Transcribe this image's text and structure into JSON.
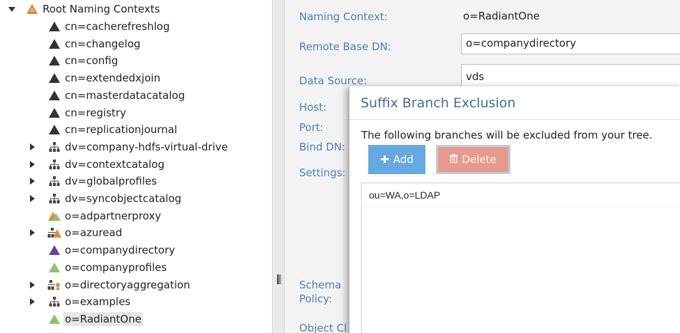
{
  "tree": {
    "root": {
      "label": "Root Naming Contexts",
      "expanded": true
    },
    "items": [
      {
        "label": "cn=cacherefreshlog",
        "icon": "triangle-black-icon",
        "expander": "none"
      },
      {
        "label": "cn=changelog",
        "icon": "triangle-black-icon",
        "expander": "none"
      },
      {
        "label": "cn=config",
        "icon": "triangle-black-icon",
        "expander": "none"
      },
      {
        "label": "cn=extendedxjoin",
        "icon": "triangle-black-icon",
        "expander": "none"
      },
      {
        "label": "cn=masterdatacatalog",
        "icon": "triangle-black-icon",
        "expander": "none"
      },
      {
        "label": "cn=registry",
        "icon": "triangle-black-icon",
        "expander": "none"
      },
      {
        "label": "cn=replicationjournal",
        "icon": "triangle-black-icon",
        "expander": "none"
      },
      {
        "label": "dv=company-hdfs-virtual-drive",
        "icon": "hierarchy-icon",
        "expander": "collapsed"
      },
      {
        "label": "dv=contextcatalog",
        "icon": "hierarchy-icon",
        "expander": "collapsed"
      },
      {
        "label": "dv=globalprofiles",
        "icon": "hierarchy-icon",
        "expander": "collapsed"
      },
      {
        "label": "dv=syncobjectcatalog",
        "icon": "hierarchy-icon",
        "expander": "collapsed"
      },
      {
        "label": "o=adpartnerproxy",
        "icon": "proxy-triangle-icon",
        "expander": "none"
      },
      {
        "label": "o=azuread",
        "icon": "hierarchy-triangle-icon",
        "expander": "collapsed"
      },
      {
        "label": "o=companydirectory",
        "icon": "triangle-purple-icon",
        "expander": "none"
      },
      {
        "label": "o=companyprofiles",
        "icon": "triangle-green-icon",
        "expander": "none"
      },
      {
        "label": "o=directoryaggregation",
        "icon": "aggregation-icon",
        "expander": "collapsed"
      },
      {
        "label": "o=examples",
        "icon": "hierarchy-icon",
        "expander": "collapsed"
      },
      {
        "label": "o=RadiantOne",
        "icon": "triangle-green-icon",
        "expander": "none",
        "selected": true
      }
    ]
  },
  "properties": {
    "naming_context_label": "Naming Context:",
    "naming_context_value": "o=RadiantOne",
    "remote_base_dn_label": "Remote Base DN:",
    "remote_base_dn_value": "o=companydirectory",
    "data_source_label": "Data Source:",
    "data_source_value": "vds",
    "host_label": "Host:",
    "port_label": "Port:",
    "bind_dn_label": "Bind DN:",
    "settings_label": "Settings:",
    "schema_policy_label_1": "Schema",
    "schema_policy_label_2": "Policy:",
    "object_class_label": "Object Cl"
  },
  "dialog": {
    "title": "Suffix Branch Exclusion",
    "description": "The following branches will be excluded from your tree.",
    "add_label": "Add",
    "delete_label": "Delete",
    "excluded_branches": [
      "ou=WA,o=LDAP"
    ]
  },
  "colors": {
    "label_blue": "#4f7fae",
    "title_blue": "#3f6e98",
    "add_button": "#66a9e0",
    "delete_button": "#e69a8e",
    "icon_green": "#8dc26f",
    "icon_purple": "#6b3fa0",
    "icon_orange": "#e08a3c"
  }
}
